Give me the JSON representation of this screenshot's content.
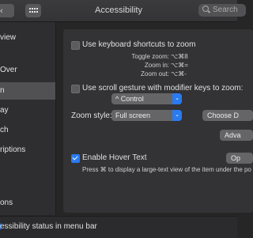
{
  "window": {
    "title": "Accessibility",
    "search_placeholder": "Search"
  },
  "sidebar": {
    "items": [
      {
        "label": "view",
        "selected": false
      },
      {
        "label": "Over",
        "selected": false
      },
      {
        "label": "n",
        "selected": true
      },
      {
        "label": "ay",
        "selected": false
      },
      {
        "label": "ch",
        "selected": false
      },
      {
        "label": "riptions",
        "selected": false
      },
      {
        "label": "ons",
        "selected": false
      }
    ]
  },
  "zoom": {
    "keyboard_shortcuts_label": "Use keyboard shortcuts to zoom",
    "keyboard_shortcuts_checked": false,
    "toggle_zoom_label": "Toggle zoom:",
    "toggle_zoom_keys": "⌥⌘8",
    "zoom_in_label": "Zoom in:",
    "zoom_in_keys": "⌥⌘=",
    "zoom_out_label": "Zoom out:",
    "zoom_out_keys": "⌥⌘-",
    "scroll_gesture_label": "Use scroll gesture with modifier keys to zoom:",
    "scroll_gesture_checked": false,
    "modifier_value": "^ Control",
    "zoom_style_label": "Zoom style:",
    "zoom_style_value": "Full screen",
    "choose_button": "Choose D",
    "advanced_button": "Adva"
  },
  "hover_text": {
    "label": "Enable Hover Text",
    "checked": true,
    "options_button": "Op",
    "hint": "Press ⌘ to display a large-text view of the item under the po"
  },
  "status_bar": {
    "label": "essibility status in menu bar"
  },
  "colors": {
    "accent": "#2a7af0",
    "window_bg": "#262626",
    "panel_bg": "#333335"
  }
}
